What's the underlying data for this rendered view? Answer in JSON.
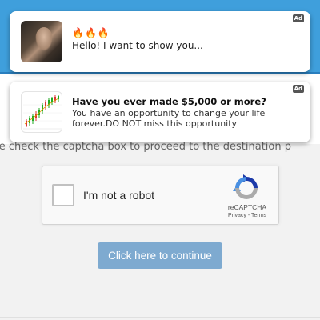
{
  "ads": [
    {
      "badge": "Ad",
      "emoji": "🔥🔥🔥",
      "text": "Hello! I want to show you..."
    },
    {
      "badge": "Ad",
      "headline": "Have you ever made $5,000 or more?",
      "body": "You have an opportunity to change your life forever.DO NOT miss this opportunity"
    }
  ],
  "page": {
    "instruction": "se check the captcha box to proceed to the destination p"
  },
  "captcha": {
    "label": "I'm not a robot",
    "brand": "reCAPTCHA",
    "privacy": "Privacy",
    "separator": " - ",
    "terms": "Terms"
  },
  "continue_button": "Click here to continue",
  "colors": {
    "header_blue": "#3f9fdc",
    "button_blue": "#7eaad0",
    "recaptcha_blue": "#1c3aa9",
    "recaptcha_light": "#4a90e2",
    "recaptcha_grey": "#ababab"
  }
}
